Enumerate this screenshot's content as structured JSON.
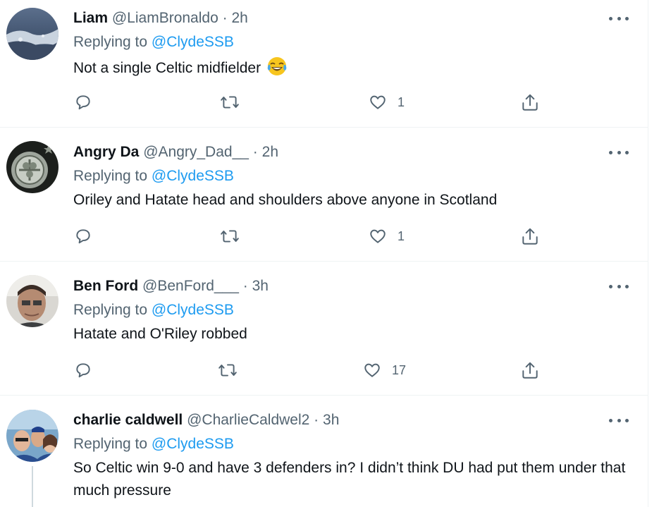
{
  "tweets": [
    {
      "name": "Liam",
      "handle": "@LiamBronaldo",
      "separator": "·",
      "time": "2h",
      "replying_prefix": "Replying to",
      "replying_to": "@ClydeSSB",
      "text": "Not a single Celtic midfielder",
      "emoji": "face-with-tears-of-joy-icon",
      "like_count": "1"
    },
    {
      "name": "Angry Da",
      "handle": "@Angry_Dad__",
      "separator": "·",
      "time": "2h",
      "replying_prefix": "Replying to",
      "replying_to": "@ClydeSSB",
      "text": "Oriley and Hatate head and shoulders above anyone in Scotland",
      "like_count": "1"
    },
    {
      "name": "Ben Ford",
      "handle": "@BenFord___",
      "separator": "·",
      "time": "3h",
      "replying_prefix": "Replying to",
      "replying_to": "@ClydeSSB",
      "text": "Hatate and O'Riley robbed",
      "like_count": "17"
    },
    {
      "name": "charlie caldwell",
      "handle": "@CharlieCaldwel2",
      "separator": "·",
      "time": "3h",
      "replying_prefix": "Replying to",
      "replying_to": "@ClydeSSB",
      "text": "So Celtic win 9-0 and have 3 defenders in? I didn’t think DU had put them under that much pressure"
    }
  ],
  "colors": {
    "text_primary": "#0f1419",
    "text_secondary": "#536471",
    "link": "#1d9bf0",
    "divider": "#eff3f4"
  },
  "icons": [
    "reply-icon",
    "retweet-icon",
    "like-icon",
    "share-icon",
    "more-icon"
  ]
}
